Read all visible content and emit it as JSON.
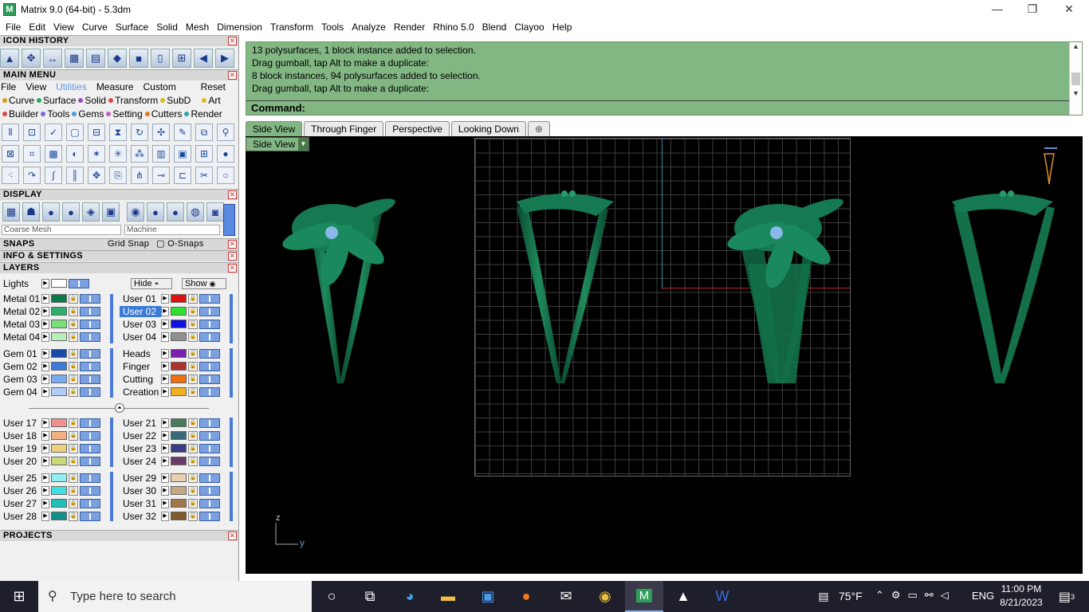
{
  "window": {
    "title": "Matrix 9.0 (64-bit) - 5.3dm",
    "app_icon": "M"
  },
  "menubar": [
    "File",
    "Edit",
    "View",
    "Curve",
    "Surface",
    "Solid",
    "Mesh",
    "Dimension",
    "Transform",
    "Tools",
    "Analyze",
    "Render",
    "Rhino 5.0",
    "Blend",
    "Clayoo",
    "Help"
  ],
  "left": {
    "icon_history_title": "ICON HISTORY",
    "main_menu_title": "MAIN MENU",
    "main_menu_tabs": [
      "File",
      "View",
      "Utilities",
      "Measure",
      "Custom"
    ],
    "reset_label": "Reset",
    "cat_row1": [
      {
        "label": "Curve",
        "color": "#d4a017"
      },
      {
        "label": "Surface",
        "color": "#2ea84a"
      },
      {
        "label": "Solid",
        "color": "#9a4ac8"
      },
      {
        "label": "Transform",
        "color": "#e04848"
      },
      {
        "label": "SubD",
        "color": "#e0b820"
      },
      {
        "label": "Art",
        "color": "#e0b820"
      }
    ],
    "cat_row2": [
      {
        "label": "Builder",
        "color": "#e04848"
      },
      {
        "label": "Tools",
        "color": "#7a6ad8"
      },
      {
        "label": "Gems",
        "color": "#4a9ae0"
      },
      {
        "label": "Setting",
        "color": "#c85ac8"
      },
      {
        "label": "Cutters",
        "color": "#e07a20"
      },
      {
        "label": "Render",
        "color": "#2ea8a8"
      }
    ],
    "display_title": "DISPLAY",
    "mesh_select": "Coarse Mesh",
    "material_select": "Machine",
    "snaps_title": "SNAPS",
    "grid_snap": "Grid Snap",
    "osnaps": "O-Snaps",
    "info_title": "INFO & SETTINGS",
    "layers_title": "LAYERS",
    "lights_label": "Lights",
    "hide_label": "Hide",
    "show_label": "Show",
    "layers_left": [
      {
        "name": "Metal 01",
        "color": "#0a7a4a"
      },
      {
        "name": "Metal 02",
        "color": "#2eae6a"
      },
      {
        "name": "Metal 03",
        "color": "#7ae07a"
      },
      {
        "name": "Metal 04",
        "color": "#b8f0b8"
      },
      {
        "name": "Gem 01",
        "color": "#1a4aa8"
      },
      {
        "name": "Gem 02",
        "color": "#3a7ad8"
      },
      {
        "name": "Gem 03",
        "color": "#7aaaf0"
      },
      {
        "name": "Gem 04",
        "color": "#b0ccf8"
      },
      {
        "name": "User 17",
        "color": "#f09090"
      },
      {
        "name": "User 18",
        "color": "#f0b080"
      },
      {
        "name": "User 19",
        "color": "#f0d080"
      },
      {
        "name": "User 20",
        "color": "#c8d878"
      },
      {
        "name": "User 25",
        "color": "#90f0f0"
      },
      {
        "name": "User 26",
        "color": "#40e0e0"
      },
      {
        "name": "User 27",
        "color": "#20c0b8"
      },
      {
        "name": "User 28",
        "color": "#109088"
      }
    ],
    "layers_right": [
      {
        "name": "User 01",
        "color": "#e01010"
      },
      {
        "name": "User 02",
        "color": "#30e030"
      },
      {
        "name": "User 03",
        "color": "#1010e0"
      },
      {
        "name": "User 04",
        "color": "#909090"
      },
      {
        "name": "Heads",
        "color": "#7a20b0"
      },
      {
        "name": "Finger",
        "color": "#b03030"
      },
      {
        "name": "Cutting",
        "color": "#f07010"
      },
      {
        "name": "Creation",
        "color": "#f0b020"
      },
      {
        "name": "User 21",
        "color": "#4a7a5a"
      },
      {
        "name": "User 22",
        "color": "#3a6a7a"
      },
      {
        "name": "User 23",
        "color": "#3a3a8a"
      },
      {
        "name": "User 24",
        "color": "#6a3a6a"
      },
      {
        "name": "User 29",
        "color": "#e8d0b0"
      },
      {
        "name": "User 30",
        "color": "#c8a880"
      },
      {
        "name": "User 31",
        "color": "#a07848"
      },
      {
        "name": "User 32",
        "color": "#805a28"
      }
    ],
    "projects_title": "PROJECTS"
  },
  "command": {
    "history": [
      "13 polysurfaces, 1 block instance added to selection.",
      "Drag gumball, tap Alt to make a duplicate:",
      "8 block instances, 94 polysurfaces added to selection.",
      "Drag gumball, tap Alt to make a duplicate:"
    ],
    "prompt": "Command:"
  },
  "viewport_tabs": [
    "Side View",
    "Through Finger",
    "Perspective",
    "Looking Down"
  ],
  "add_tab_icon": "⊕",
  "viewport": {
    "label": "Side View",
    "axis_z": "z",
    "axis_y": "y"
  },
  "taskbar": {
    "search_placeholder": "Type here to search",
    "weather": "75°F",
    "lang": "ENG",
    "time": "11:00 PM",
    "date": "8/21/2023",
    "notif_count": "3"
  }
}
